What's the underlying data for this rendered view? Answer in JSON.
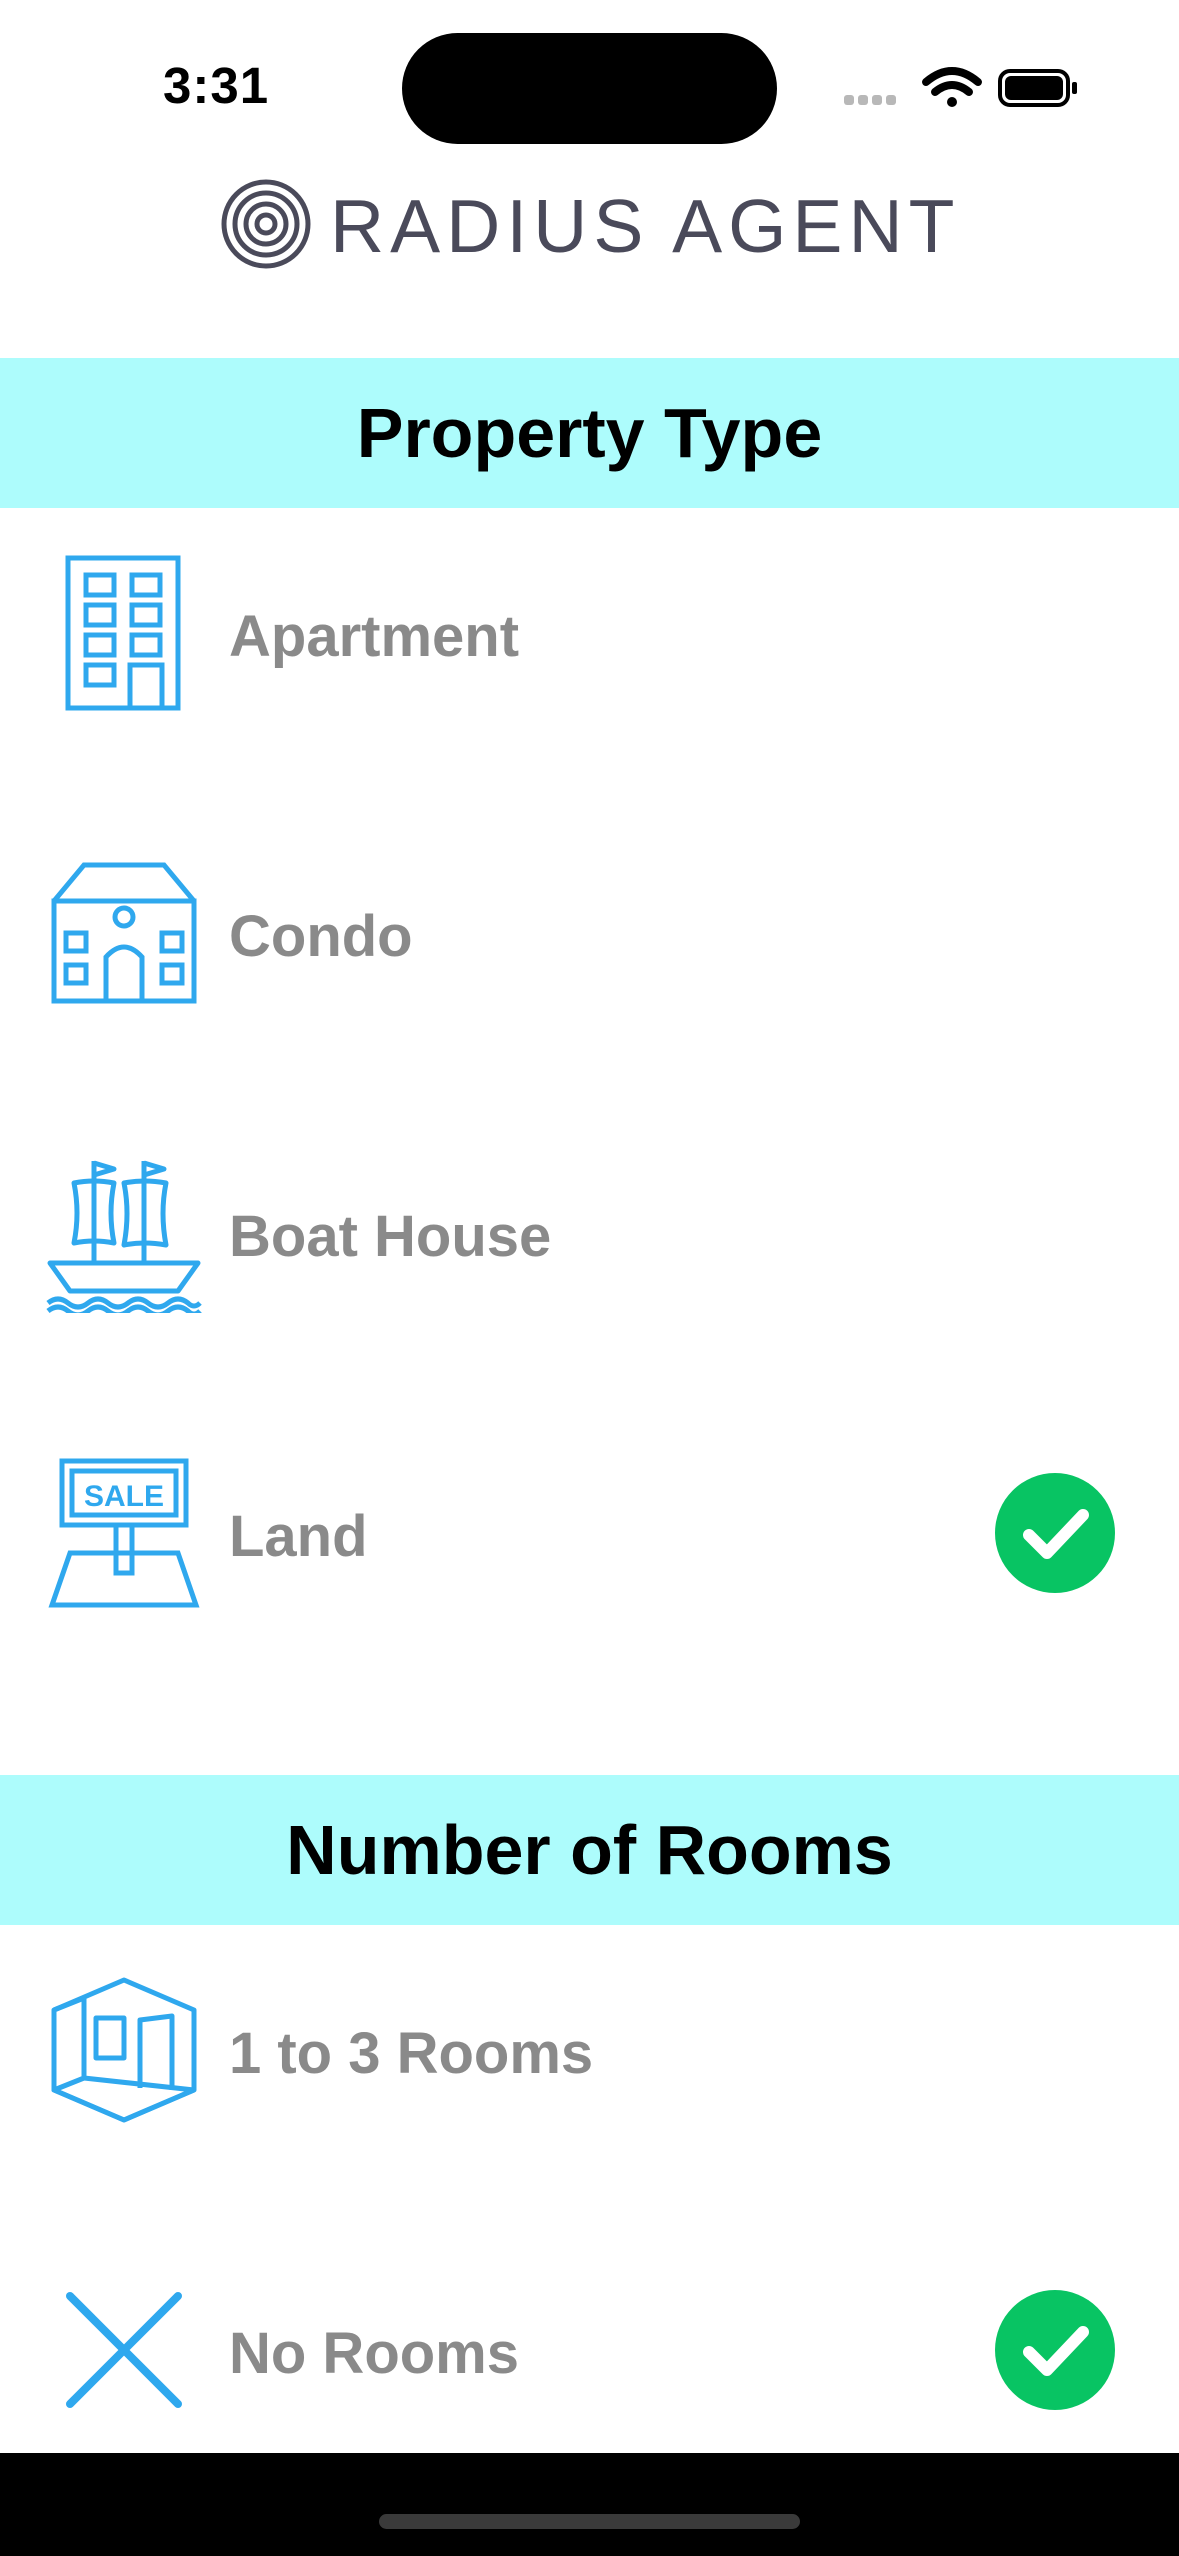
{
  "status_bar": {
    "time": "3:31",
    "signal_icon": "cellular-dots-icon",
    "wifi_icon": "wifi-icon",
    "battery_icon": "battery-full-icon"
  },
  "header": {
    "logo_text": "RADIUS AGENT",
    "logo_icon": "radius-rings-logo-icon"
  },
  "colors": {
    "section_bg": "#adfcfc",
    "icon_blue": "#2fa8ee",
    "check_green": "#08c463",
    "label_gray": "#8a8a8a"
  },
  "property_type": {
    "title": "Property Type",
    "items": [
      {
        "label": "Apartment",
        "icon": "apartment-building-icon",
        "selected": false
      },
      {
        "label": "Condo",
        "icon": "condo-house-icon",
        "selected": false
      },
      {
        "label": "Boat House",
        "icon": "sailing-ship-icon",
        "selected": false
      },
      {
        "label": "Land",
        "icon": "sale-sign-icon",
        "sign_text": "SALE",
        "selected": true
      }
    ]
  },
  "rooms": {
    "title": "Number of Rooms",
    "items": [
      {
        "label": "1 to 3 Rooms",
        "icon": "room-cube-icon",
        "selected": false
      },
      {
        "label": "No Rooms",
        "icon": "x-cross-icon",
        "selected": true
      }
    ]
  }
}
